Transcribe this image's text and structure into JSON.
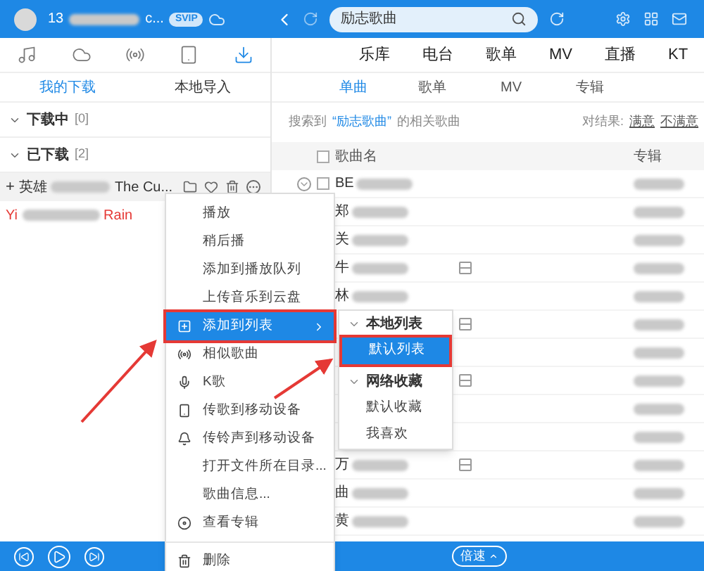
{
  "user": {
    "name_start": "13",
    "name_end": "c...",
    "badge": "SVIP"
  },
  "search": {
    "value": "励志歌曲"
  },
  "icon_tabs": [
    {
      "kind": "music",
      "selected": false
    },
    {
      "kind": "cloud",
      "selected": false
    },
    {
      "kind": "radio",
      "selected": false
    },
    {
      "kind": "device",
      "selected": false
    },
    {
      "kind": "download",
      "selected": true
    }
  ],
  "left_tabs": [
    {
      "label": "我的下载",
      "selected": true
    },
    {
      "label": "本地导入",
      "selected": false
    }
  ],
  "groups": [
    {
      "label": "下载中",
      "count": "[0]",
      "expanded": true
    },
    {
      "label": "已下载",
      "count": "[2]",
      "expanded": true
    }
  ],
  "downloads": [
    {
      "prefix": "+",
      "start": "英雄",
      "end": "The Cu...",
      "playing": false,
      "hovered": true
    },
    {
      "start": "Yi",
      "end": "Rain",
      "playing": true,
      "hovered": false
    }
  ],
  "nav": [
    "乐库",
    "电台",
    "歌单",
    "MV",
    "直播",
    "KT"
  ],
  "result_tabs": [
    {
      "label": "单曲",
      "selected": true
    },
    {
      "label": "歌单",
      "selected": false
    },
    {
      "label": "MV",
      "selected": false
    },
    {
      "label": "专辑",
      "selected": false
    }
  ],
  "result": {
    "prefix": "搜索到",
    "query": "“励志歌曲”",
    "suffix": "的相关歌曲",
    "feedback_label": "对结果:",
    "satisfied": "满意",
    "unsatisfied": "不满意"
  },
  "columns": [
    "歌曲名",
    "专辑"
  ],
  "header_checked": false,
  "songs": [
    {
      "title": "BE",
      "checked": false,
      "mv": false
    },
    {
      "title": "郑",
      "mv": false
    },
    {
      "title": "关",
      "mv": false
    },
    {
      "title": "牛",
      "mv": true
    },
    {
      "title": "林",
      "mv": false
    },
    {
      "mv": true
    },
    {
      "mv": false
    },
    {
      "mv": true
    },
    {
      "mv": false
    },
    {
      "mv": false
    },
    {
      "title": "万",
      "mv": true
    },
    {
      "title": "曲",
      "mv": false
    },
    {
      "title": "黄",
      "mv": false
    }
  ],
  "context_menu": [
    {
      "kind": "plain",
      "label": "播放",
      "selected": false
    },
    {
      "kind": "plain",
      "label": "稍后播",
      "selected": false
    },
    {
      "kind": "plain",
      "label": "添加到播放队列",
      "selected": false
    },
    {
      "kind": "plain",
      "label": "上传音乐到云盘",
      "selected": false
    },
    {
      "kind": "add",
      "label": "添加到列表",
      "selected": true,
      "submenu": true
    },
    {
      "kind": "radio",
      "label": "相似歌曲",
      "selected": false
    },
    {
      "kind": "mic",
      "label": "K歌",
      "selected": false
    },
    {
      "kind": "phone",
      "label": "传歌到移动设备",
      "selected": false
    },
    {
      "kind": "bell",
      "label": "传铃声到移动设备",
      "selected": false
    },
    {
      "kind": "plain",
      "label": "打开文件所在目录...",
      "selected": false
    },
    {
      "kind": "plain",
      "label": "歌曲信息...",
      "selected": false
    },
    {
      "kind": "disc",
      "label": "查看专辑",
      "selected": false
    },
    {
      "kind": "divider"
    },
    {
      "kind": "trash",
      "label": "删除",
      "selected": false
    }
  ],
  "submenu": [
    {
      "kind": "header",
      "label": "本地列表",
      "expanded": true
    },
    {
      "kind": "item",
      "label": "默认列表",
      "selected": true
    },
    {
      "kind": "header",
      "label": "网络收藏",
      "expanded": true
    },
    {
      "kind": "item",
      "label": "默认收藏",
      "selected": false
    },
    {
      "kind": "item",
      "label": "我喜欢",
      "selected": false
    }
  ],
  "bottom": {
    "speed": "倍速"
  }
}
